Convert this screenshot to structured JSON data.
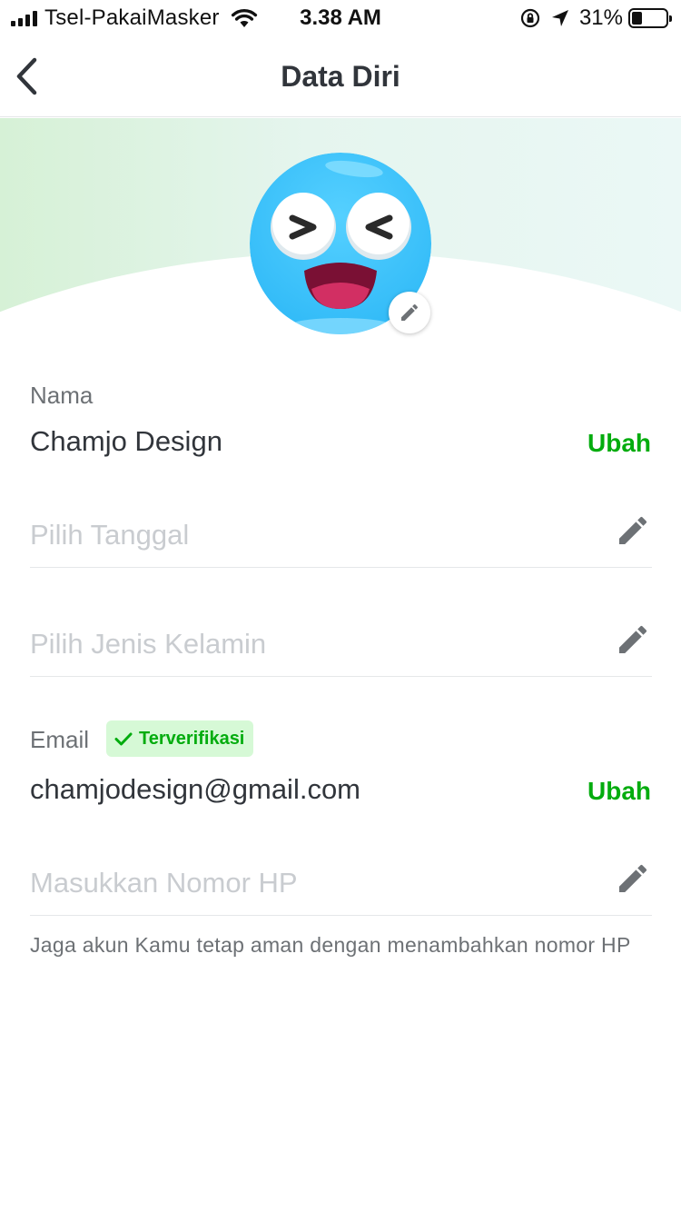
{
  "status_bar": {
    "carrier": "Tsel-PakaiMasker",
    "time": "3.38 AM",
    "battery_percent": "31%",
    "battery_level": 0.31
  },
  "nav": {
    "title": "Data Diri"
  },
  "profile": {
    "name_label": "Nama",
    "name_value": "Chamjo Design",
    "name_action": "Ubah",
    "birthdate_placeholder": "Pilih Tanggal",
    "gender_placeholder": "Pilih Jenis Kelamin",
    "email_label": "Email",
    "email_badge": "Terverifikasi",
    "email_value": "chamjodesign@gmail.com",
    "email_action": "Ubah",
    "phone_placeholder": "Masukkan Nomor HP",
    "phone_helper": "Jaga akun Kamu tetap aman dengan menambahkan nomor HP"
  },
  "colors": {
    "accent_green": "#03ac0e",
    "badge_bg": "#d6f9d6",
    "avatar_blue": "#3fc4fb"
  },
  "icons": {
    "back": "chevron-left-icon",
    "edit": "pencil-icon",
    "verified": "check-icon"
  }
}
